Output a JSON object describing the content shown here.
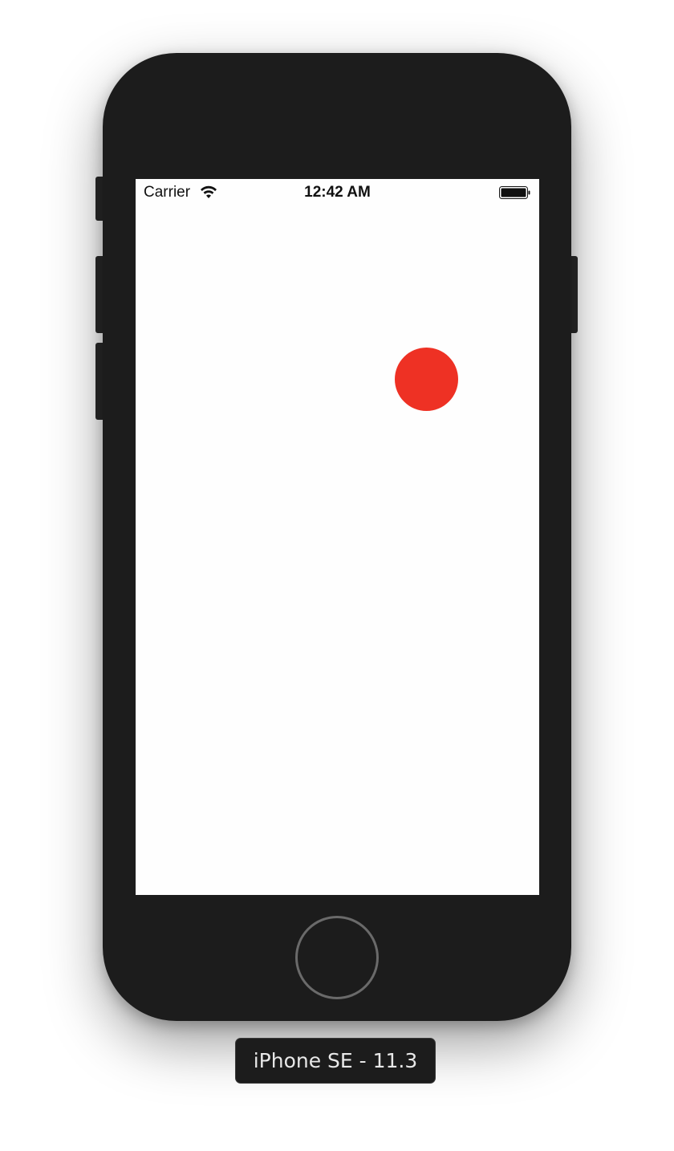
{
  "status_bar": {
    "carrier": "Carrier",
    "time": "12:42 AM",
    "wifi_icon": "wifi-icon",
    "battery_icon": "battery-full-icon"
  },
  "content": {
    "dot_color": "#ee3124"
  },
  "device": {
    "label": "iPhone SE - 11.3",
    "home_button_icon": "home-button-ring"
  }
}
